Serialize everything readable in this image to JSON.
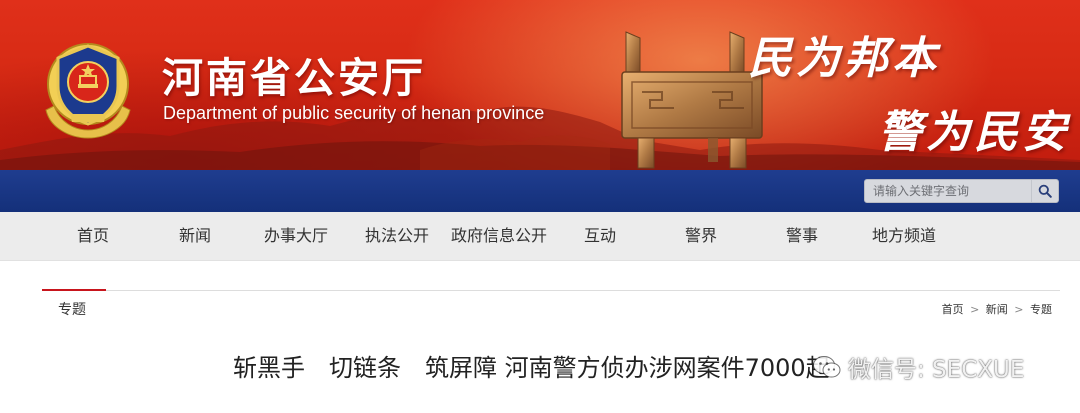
{
  "header": {
    "title": "河南省公安厅",
    "subtitle": "Department of public security of henan province",
    "slogan_line1": "民为邦本",
    "slogan_line2": "警为民安"
  },
  "search": {
    "placeholder": "请输入关键字查询",
    "icon": "search-icon"
  },
  "nav": {
    "items": [
      "首页",
      "新闻",
      "办事大厅",
      "执法公开",
      "政府信息公开",
      "互动",
      "警界",
      "警事",
      "地方频道"
    ]
  },
  "section": {
    "label": "专题"
  },
  "breadcrumb": {
    "items": [
      "首页",
      "新闻",
      "专题"
    ],
    "separator": ">"
  },
  "article": {
    "title": "斩黑手　切链条　筑屏障 河南警方侦办涉网案件7000起"
  },
  "watermark": {
    "text": "微信号: SECXUE",
    "icon": "wechat-icon"
  },
  "colors": {
    "banner_red": "#d62a14",
    "bar_blue": "#1a3682",
    "nav_gray": "#ececec",
    "accent_red": "#c8151d"
  }
}
